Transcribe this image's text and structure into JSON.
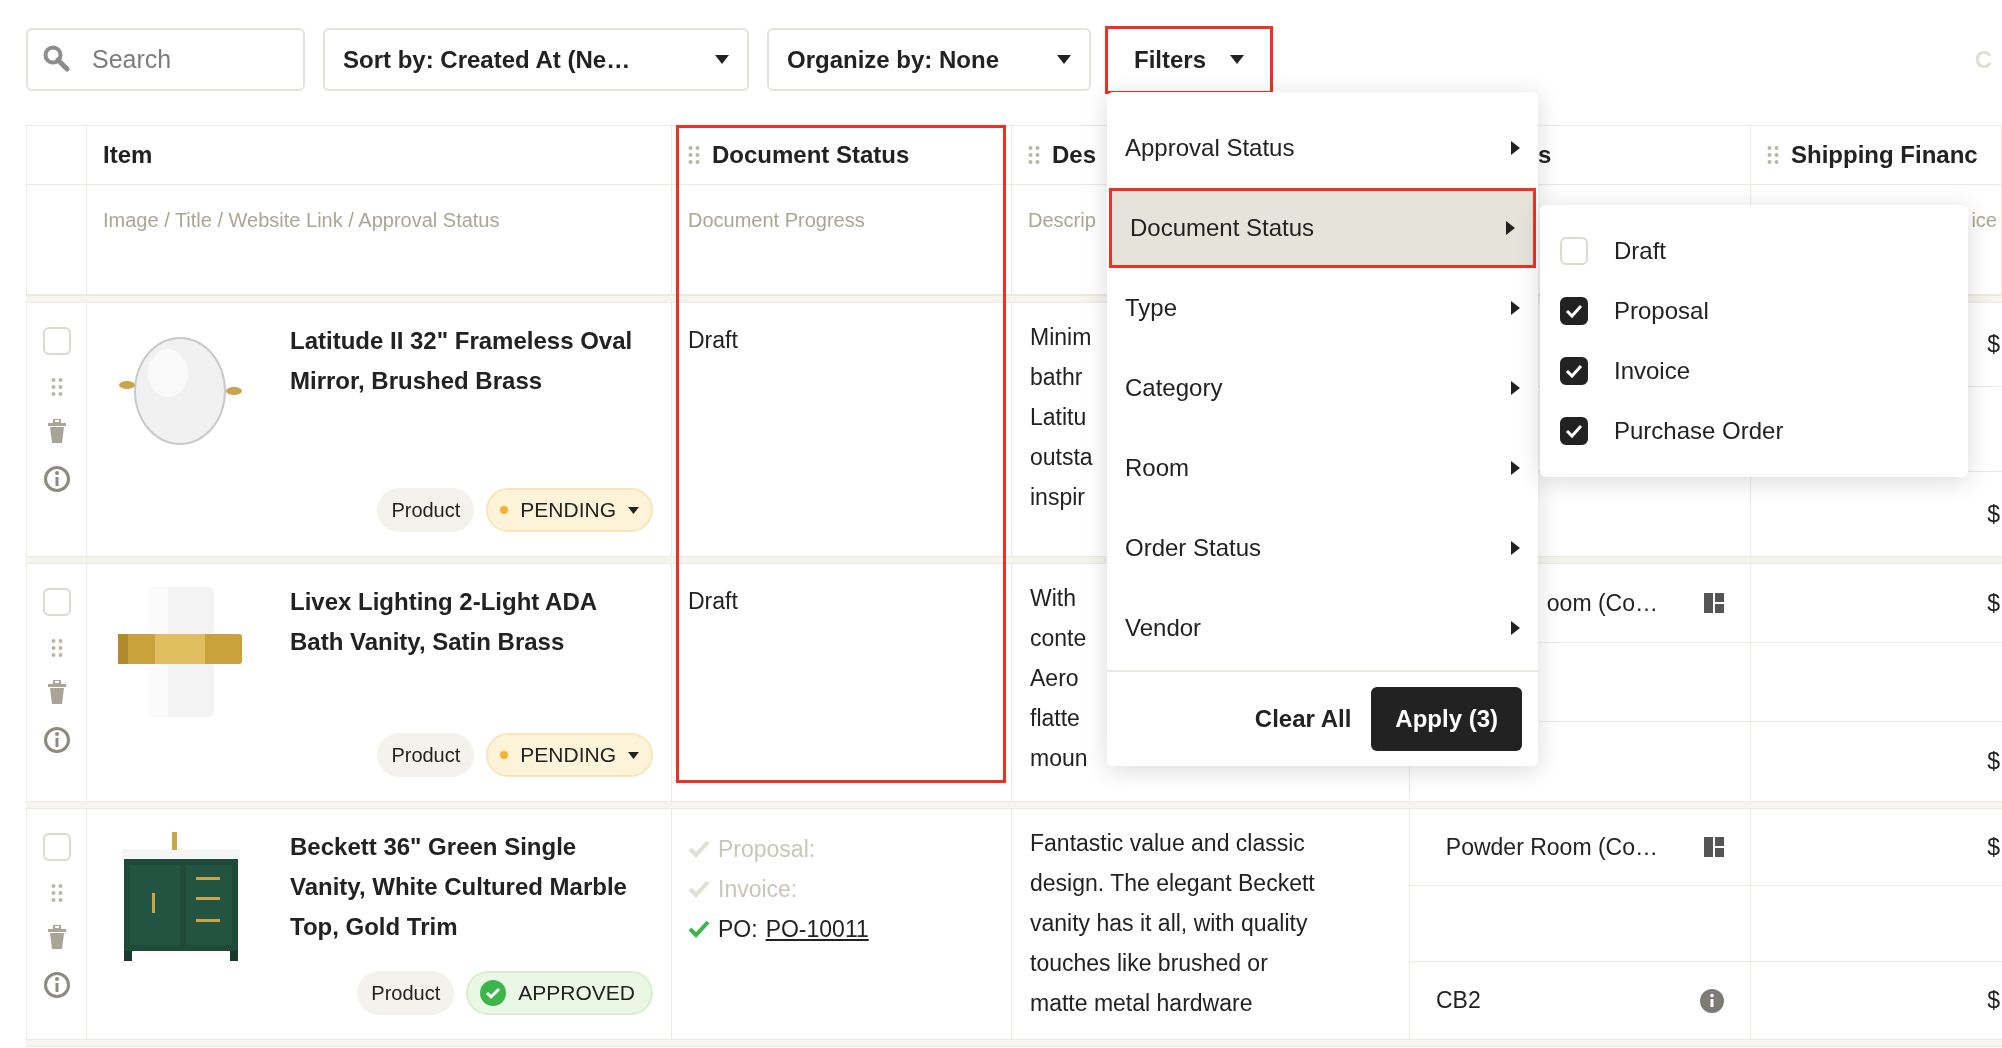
{
  "toolbar": {
    "search": {
      "placeholder": "Search"
    },
    "sort": "Sort by: Created At (Ne…",
    "organize": "Organize by: None",
    "filters": {
      "label": "Filters",
      "highlighted": true
    },
    "cut_button": "C"
  },
  "table": {
    "columns": [
      {
        "title": "Item",
        "subtitle": "Image / Title / Website Link / Approval Status",
        "handle": false
      },
      {
        "title": "Document Status",
        "subtitle": "Document Progress",
        "handle": true,
        "highlighted": true
      },
      {
        "title": "Des",
        "subtitle": "Descrip",
        "handle": true
      },
      {
        "title": "s",
        "handle": false
      },
      {
        "title": "Shipping Financ",
        "subtitle": "ice",
        "handle": true
      }
    ],
    "rows": [
      {
        "checked": false,
        "picture": {
          "kind": "picture"
        },
        "title": "Latitude II 32\" Frameless Oval Mirror, Brushed Brass",
        "type": "Product",
        "approval": {
          "label": "PENDING",
          "kind": "pending"
        },
        "document": {
          "kind": "text",
          "text": "Draft"
        },
        "description": [
          "Minim",
          "bathr",
          "Latitu",
          "outsta",
          "inspir"
        ],
        "details": [
          {
            "kind": "empty"
          },
          {
            "kind": "empty"
          },
          {
            "kind": "empty"
          }
        ],
        "amount_top": "$",
        "amount_bottom": "$"
      },
      {
        "checked": false,
        "picture": {
          "kind": "picture"
        },
        "title": "Livex Lighting 2-Light ADA Bath Vanity, Satin Brass",
        "type": "Product",
        "approval": {
          "label": "PENDING",
          "kind": "pending"
        },
        "document": {
          "kind": "text",
          "text": "Draft"
        },
        "description": [
          "With",
          "conte",
          "Aero",
          "flatte",
          "moun"
        ],
        "details": [
          {
            "kind": "room",
            "text": "oom (Co…"
          },
          {
            "kind": "empty"
          },
          {
            "kind": "empty"
          }
        ],
        "amount_top": "$",
        "amount_bottom": "$"
      },
      {
        "checked": false,
        "picture": {
          "kind": "picture"
        },
        "title": "Beckett 36\" Green Single Vanity, White Cultured Marble Top, Gold Trim",
        "type": "Product",
        "approval": {
          "label": "APPROVED",
          "kind": "approved"
        },
        "document": {
          "kind": "checklist",
          "items": [
            {
              "label": "Proposal:",
              "done": false
            },
            {
              "label": "Invoice:",
              "done": false
            },
            {
              "label": "PO:",
              "link": "PO-10011",
              "done": true
            }
          ]
        },
        "description": [
          "Fantastic value and classic",
          "design. The elegant Beckett",
          "vanity has it all, with quality",
          "touches like brushed or",
          "matte metal hardware"
        ],
        "details": [
          {
            "kind": "room",
            "text": "Powder Room (Co…"
          },
          {
            "kind": "empty"
          },
          {
            "kind": "vendor",
            "text": "CB2"
          }
        ],
        "amount_top": "$",
        "amount_bottom": "$"
      }
    ]
  },
  "filter_menu": {
    "items": [
      {
        "label": "Approval Status",
        "selected": false
      },
      {
        "label": "Document Status",
        "selected": true
      },
      {
        "label": "Type",
        "selected": false
      },
      {
        "label": "Category",
        "selected": false
      },
      {
        "label": "Room",
        "selected": false
      },
      {
        "label": "Order Status",
        "selected": false
      },
      {
        "label": "Vendor",
        "selected": false
      }
    ],
    "clear": "Clear All",
    "apply": "Apply (3)",
    "submenu": [
      {
        "label": "Draft",
        "checked": false
      },
      {
        "label": "Proposal",
        "checked": true
      },
      {
        "label": "Invoice",
        "checked": true
      },
      {
        "label": "Purchase Order",
        "checked": true
      }
    ]
  }
}
